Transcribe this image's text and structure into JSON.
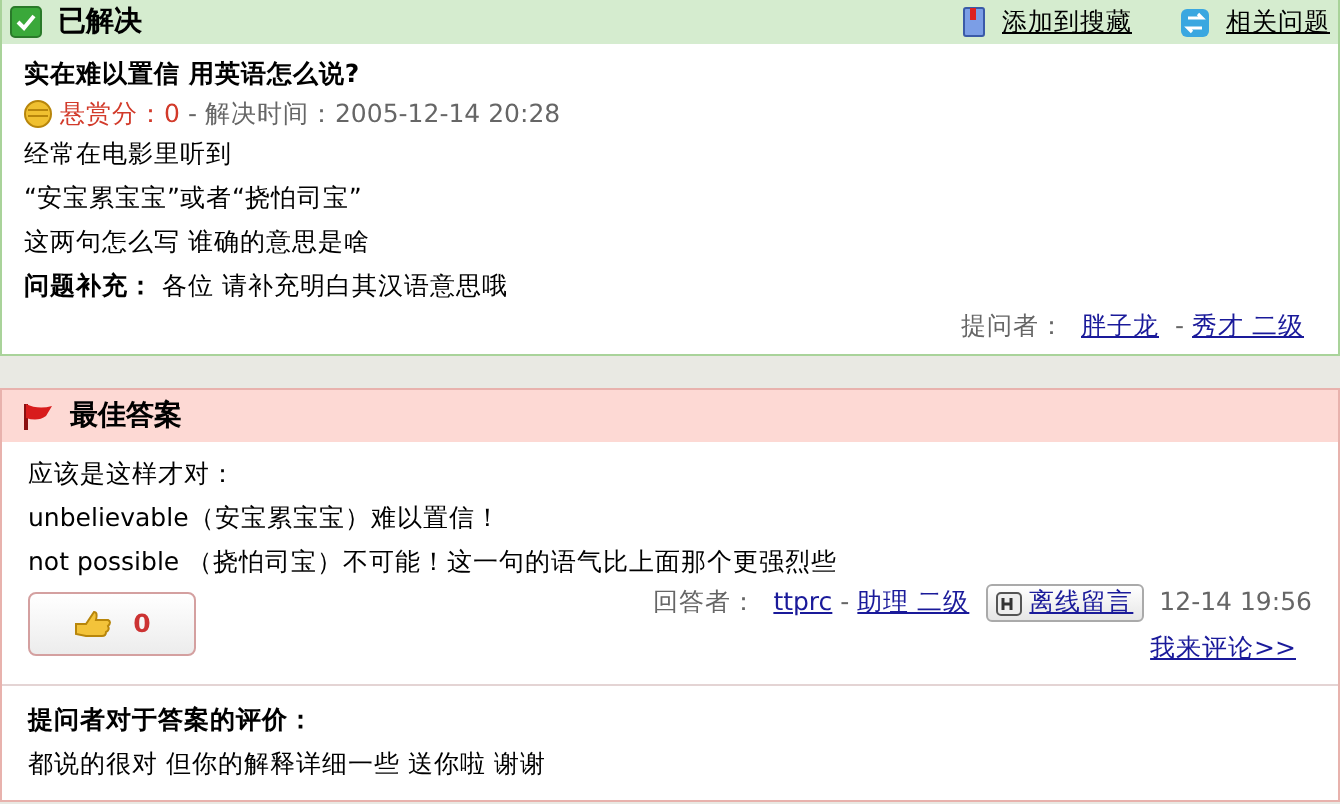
{
  "question": {
    "status": "已解决",
    "actions": [
      {
        "label": "添加到搜藏",
        "kind": "bookmark"
      },
      {
        "label": "相关问题",
        "kind": "related"
      }
    ],
    "title": "实在难以置信  用英语怎么说?",
    "reward": "悬赏分：0",
    "separator": "-",
    "solved": "解决时间：2005-12-14 20:28",
    "body": [
      "经常在电影里听到",
      "“安宝累宝宝”或者“挠怕司宝”",
      "这两句怎么写  谁确的意思是啥"
    ],
    "supplement_label": "问题补充：",
    "supplement": "各位  请补充明白其汉语意思哦",
    "asker_label": "提问者：",
    "asker": "胖子龙",
    "asker_separator": "-",
    "asker_rank": "秀才 二级"
  },
  "answer": {
    "title": "最佳答案",
    "lines": [
      "应该是这样才对：",
      "unbelievable（安宝累宝宝）难以置信！",
      "not possible （挠怕司宝）不可能！这一句的语气比上面那个更强烈些"
    ],
    "votes": "0",
    "answerer_label": "回答者：",
    "answerer": "ttprc",
    "answerer_separator": "-",
    "answerer_rank": "助理 二级",
    "message_button": "离线留言",
    "time": "12-14 19:56",
    "comment_link": "我来评论>>",
    "evaluation_label": "提问者对于答案的评价：",
    "evaluation": "都说的很对 但你的解释详细一些 送你啦 谢谢"
  }
}
